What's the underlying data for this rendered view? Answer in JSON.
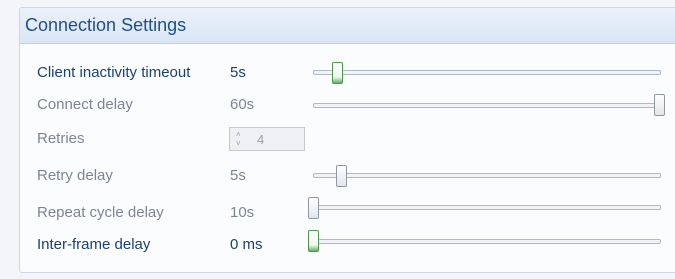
{
  "panel": {
    "title": "Connection Settings",
    "rows": [
      {
        "label": "Client inactivity timeout",
        "value": "5s",
        "enabled": true,
        "slider_level": 0.06
      },
      {
        "label": "Connect delay",
        "value": "60s",
        "enabled": false,
        "slider_level": 1.0
      },
      {
        "label": "Retries",
        "value": "4",
        "enabled": false,
        "spin_up": "˄",
        "spin_down": "˅"
      },
      {
        "label": "Retry delay",
        "value": "5s",
        "enabled": false,
        "slider_level": 0.08
      },
      {
        "label": "Repeat cycle delay",
        "value": "10s",
        "enabled": false,
        "slider_level": 0.0
      },
      {
        "label": "Inter-frame delay",
        "value": "0 ms",
        "enabled": true,
        "slider_level": 0.0
      }
    ]
  },
  "colors": {
    "enabled_text": "#1c3f78",
    "disabled_text": "#7c8593",
    "title_text": "#1f4f8f",
    "active_thumb_accent": "#5fb25f"
  }
}
